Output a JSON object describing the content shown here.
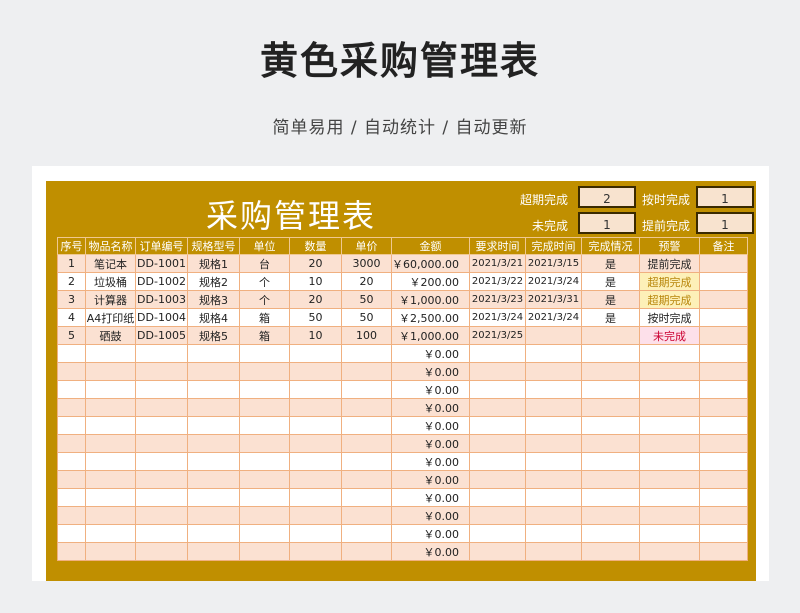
{
  "header": {
    "title": "黄色采购管理表",
    "subtitle": "简单易用 / 自动统计 / 自动更新"
  },
  "sheet": {
    "title": "采购管理表",
    "stats": {
      "overdue_label": "超期完成",
      "overdue_value": "2",
      "ontime_label": "按时完成",
      "ontime_value": "1",
      "incomplete_label": "未完成",
      "incomplete_value": "1",
      "early_label": "提前完成",
      "early_value": "1"
    },
    "columns": [
      "序号",
      "物品名称",
      "订单编号",
      "规格型号",
      "单位",
      "数量",
      "单价",
      "金额",
      "要求时间",
      "完成时间",
      "完成情况",
      "预警",
      "备注"
    ],
    "rows": [
      [
        "1",
        "笔记本",
        "DD-1001",
        "规格1",
        "台",
        "20",
        "3000",
        "￥60,000.00",
        "2021/3/21",
        "2021/3/15",
        "是",
        "提前完成",
        ""
      ],
      [
        "2",
        "垃圾桶",
        "DD-1002",
        "规格2",
        "个",
        "10",
        "20",
        "￥200.00",
        "2021/3/22",
        "2021/3/24",
        "是",
        "超期完成",
        ""
      ],
      [
        "3",
        "计算器",
        "DD-1003",
        "规格3",
        "个",
        "20",
        "50",
        "￥1,000.00",
        "2021/3/23",
        "2021/3/31",
        "是",
        "超期完成",
        ""
      ],
      [
        "4",
        "A4打印纸",
        "DD-1004",
        "规格4",
        "箱",
        "50",
        "50",
        "￥2,500.00",
        "2021/3/24",
        "2021/3/24",
        "是",
        "按时完成",
        ""
      ],
      [
        "5",
        "硒鼓",
        "DD-1005",
        "规格5",
        "箱",
        "10",
        "100",
        "￥1,000.00",
        "2021/3/25",
        "",
        "",
        "未完成",
        ""
      ],
      [
        "",
        "",
        "",
        "",
        "",
        "",
        "",
        "￥0.00",
        "",
        "",
        "",
        "",
        ""
      ],
      [
        "",
        "",
        "",
        "",
        "",
        "",
        "",
        "￥0.00",
        "",
        "",
        "",
        "",
        ""
      ],
      [
        "",
        "",
        "",
        "",
        "",
        "",
        "",
        "￥0.00",
        "",
        "",
        "",
        "",
        ""
      ],
      [
        "",
        "",
        "",
        "",
        "",
        "",
        "",
        "￥0.00",
        "",
        "",
        "",
        "",
        ""
      ],
      [
        "",
        "",
        "",
        "",
        "",
        "",
        "",
        "￥0.00",
        "",
        "",
        "",
        "",
        ""
      ],
      [
        "",
        "",
        "",
        "",
        "",
        "",
        "",
        "￥0.00",
        "",
        "",
        "",
        "",
        ""
      ],
      [
        "",
        "",
        "",
        "",
        "",
        "",
        "",
        "￥0.00",
        "",
        "",
        "",
        "",
        ""
      ],
      [
        "",
        "",
        "",
        "",
        "",
        "",
        "",
        "￥0.00",
        "",
        "",
        "",
        "",
        ""
      ],
      [
        "",
        "",
        "",
        "",
        "",
        "",
        "",
        "￥0.00",
        "",
        "",
        "",
        "",
        ""
      ],
      [
        "",
        "",
        "",
        "",
        "",
        "",
        "",
        "￥0.00",
        "",
        "",
        "",
        "",
        ""
      ],
      [
        "",
        "",
        "",
        "",
        "",
        "",
        "",
        "￥0.00",
        "",
        "",
        "",
        "",
        ""
      ],
      [
        "",
        "",
        "",
        "",
        "",
        "",
        "",
        "￥0.00",
        "",
        "",
        "",
        "",
        ""
      ]
    ]
  },
  "colors": {
    "sheet_bg": "#c08f00",
    "row_odd": "#fbe1d2",
    "border": "#f0b080",
    "warn_early_bg": "#fdf0b8",
    "warn_late_bg": "#fde0ea"
  }
}
